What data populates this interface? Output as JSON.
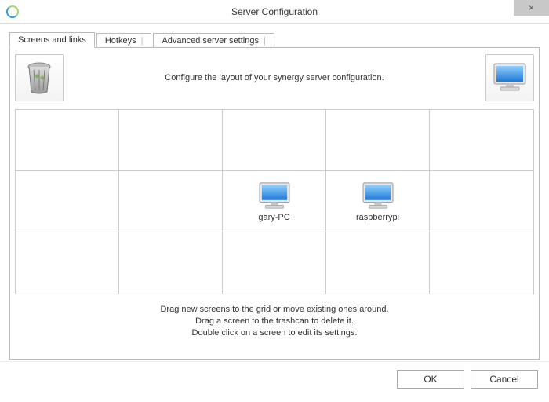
{
  "window": {
    "title": "Server Configuration",
    "close_label": "×"
  },
  "tabs": [
    {
      "label": "Screens and links",
      "active": true
    },
    {
      "label": "Hotkeys",
      "active": false
    },
    {
      "label": "Advanced server settings",
      "active": false
    }
  ],
  "top_message": "Configure the layout of your synergy server configuration.",
  "grid": {
    "rows": 3,
    "cols": 5,
    "screens": [
      {
        "row": 1,
        "col": 2,
        "name": "gary-PC"
      },
      {
        "row": 1,
        "col": 3,
        "name": "raspberrypi"
      }
    ]
  },
  "hints": {
    "line1": "Drag new screens to the grid or move existing ones around.",
    "line2": "Drag a screen to the trashcan to delete it.",
    "line3": "Double click on a screen to edit its settings."
  },
  "buttons": {
    "ok": "OK",
    "cancel": "Cancel"
  },
  "icons": {
    "trash": "trash-icon",
    "monitor": "monitor-icon",
    "app": "synergy-app-icon"
  }
}
